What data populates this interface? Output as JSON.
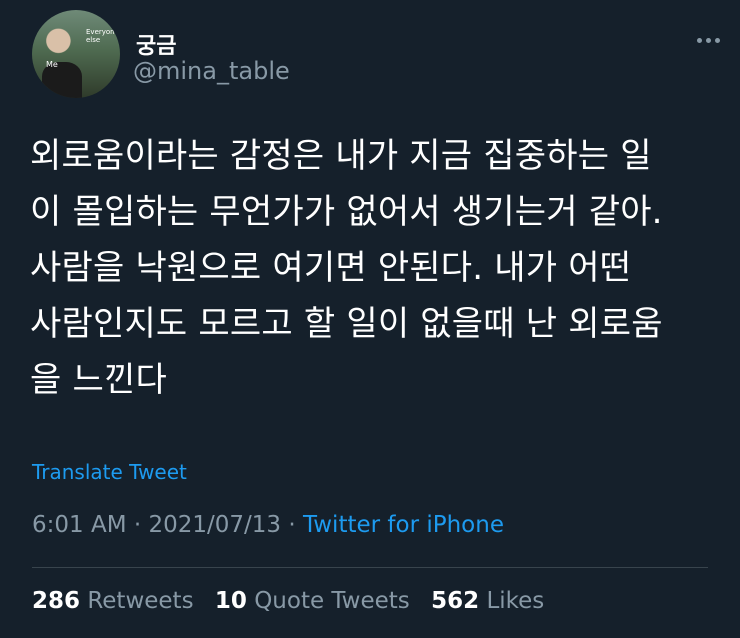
{
  "author": {
    "display_name": "궁금",
    "handle": "@mina_table",
    "avatar_caption": "Me",
    "avatar_tag": "Everyone else"
  },
  "tweet": {
    "lines": [
      "외로움이라는 감정은 내가 지금 집중하는 일",
      "이 몰입하는 무언가가 없어서 생기는거 같아.",
      "사람을 낙원으로 여기면 안된다. 내가 어떤",
      "사람인지도 모르고 할 일이 없을때 난 외로움",
      "을 느낀다"
    ]
  },
  "translate_label": "Translate Tweet",
  "meta": {
    "time": "6:01 AM",
    "separator": "·",
    "date": "2021/07/13",
    "source": "Twitter for iPhone"
  },
  "stats": {
    "retweets_count": "286",
    "retweets_label": "Retweets",
    "quotes_count": "10",
    "quotes_label": "Quote Tweets",
    "likes_count": "562",
    "likes_label": "Likes"
  },
  "colors": {
    "background": "#15202b",
    "accent": "#1d9bf0",
    "muted": "#8899a6"
  }
}
